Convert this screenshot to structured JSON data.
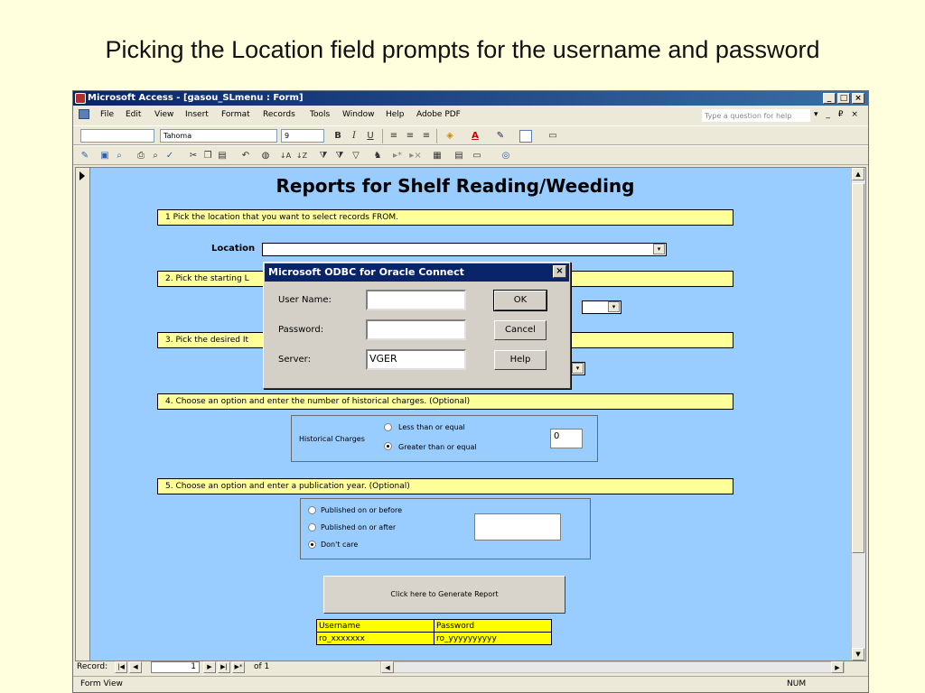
{
  "slide": {
    "title": "Picking the Location field prompts for the username and password"
  },
  "window": {
    "title": "Microsoft Access - [gasou_SLmenu : Form]",
    "controls": {
      "minimize": "_",
      "restore": "□",
      "close": "×"
    }
  },
  "menu": {
    "items": [
      "File",
      "Edit",
      "View",
      "Insert",
      "Format",
      "Records",
      "Tools",
      "Window",
      "Help",
      "Adobe PDF"
    ],
    "help_placeholder": "Type a question for help",
    "doc_controls": "▾ _ ₽ ×"
  },
  "format_toolbar": {
    "object_value": "",
    "font": "Tahoma",
    "size": "9",
    "bold": "B",
    "italic": "I",
    "underline": "U",
    "font_color_glyph": "A"
  },
  "form": {
    "heading": "Reports for Shelf Reading/Weeding",
    "step1": "1  Pick the location that you want to select records FROM.",
    "location_label": "Location",
    "location_value": "",
    "step2": "2.  Pick the starting L",
    "step3": "3.  Pick the desired It",
    "step4": "4.  Choose an option and enter the number of historical charges. (Optional)",
    "historical": {
      "label": "Historical Charges",
      "options": [
        "Less than or equal",
        "Greater than or equal"
      ],
      "selected": 1,
      "value": "0"
    },
    "step5": "5.  Choose an option and enter a publication year. (Optional)",
    "pubyear": {
      "options": [
        "Published on or before",
        "Published on or after",
        "Don't care"
      ],
      "selected": 2,
      "value": ""
    },
    "generate_button": "Click here to Generate  Report",
    "credentials": {
      "headers": [
        "Username",
        "Password"
      ],
      "values": [
        "ro_xxxxxxx",
        "ro_yyyyyyyyyy"
      ]
    }
  },
  "dialog": {
    "title": "Microsoft ODBC for Oracle Connect",
    "close": "×",
    "user_label": "User Name:",
    "user_value": "",
    "password_label": "Password:",
    "password_value": "",
    "server_label": "Server:",
    "server_value": "VGER",
    "ok": "OK",
    "cancel": "Cancel",
    "help": "Help"
  },
  "navigation": {
    "record_label": "Record:",
    "current": "1",
    "of_text": "of 1",
    "first": "|◀",
    "prev": "◀",
    "next": "▶",
    "last": "▶|",
    "new": "▶*"
  },
  "status": {
    "left": "Form View",
    "right": "NUM"
  }
}
